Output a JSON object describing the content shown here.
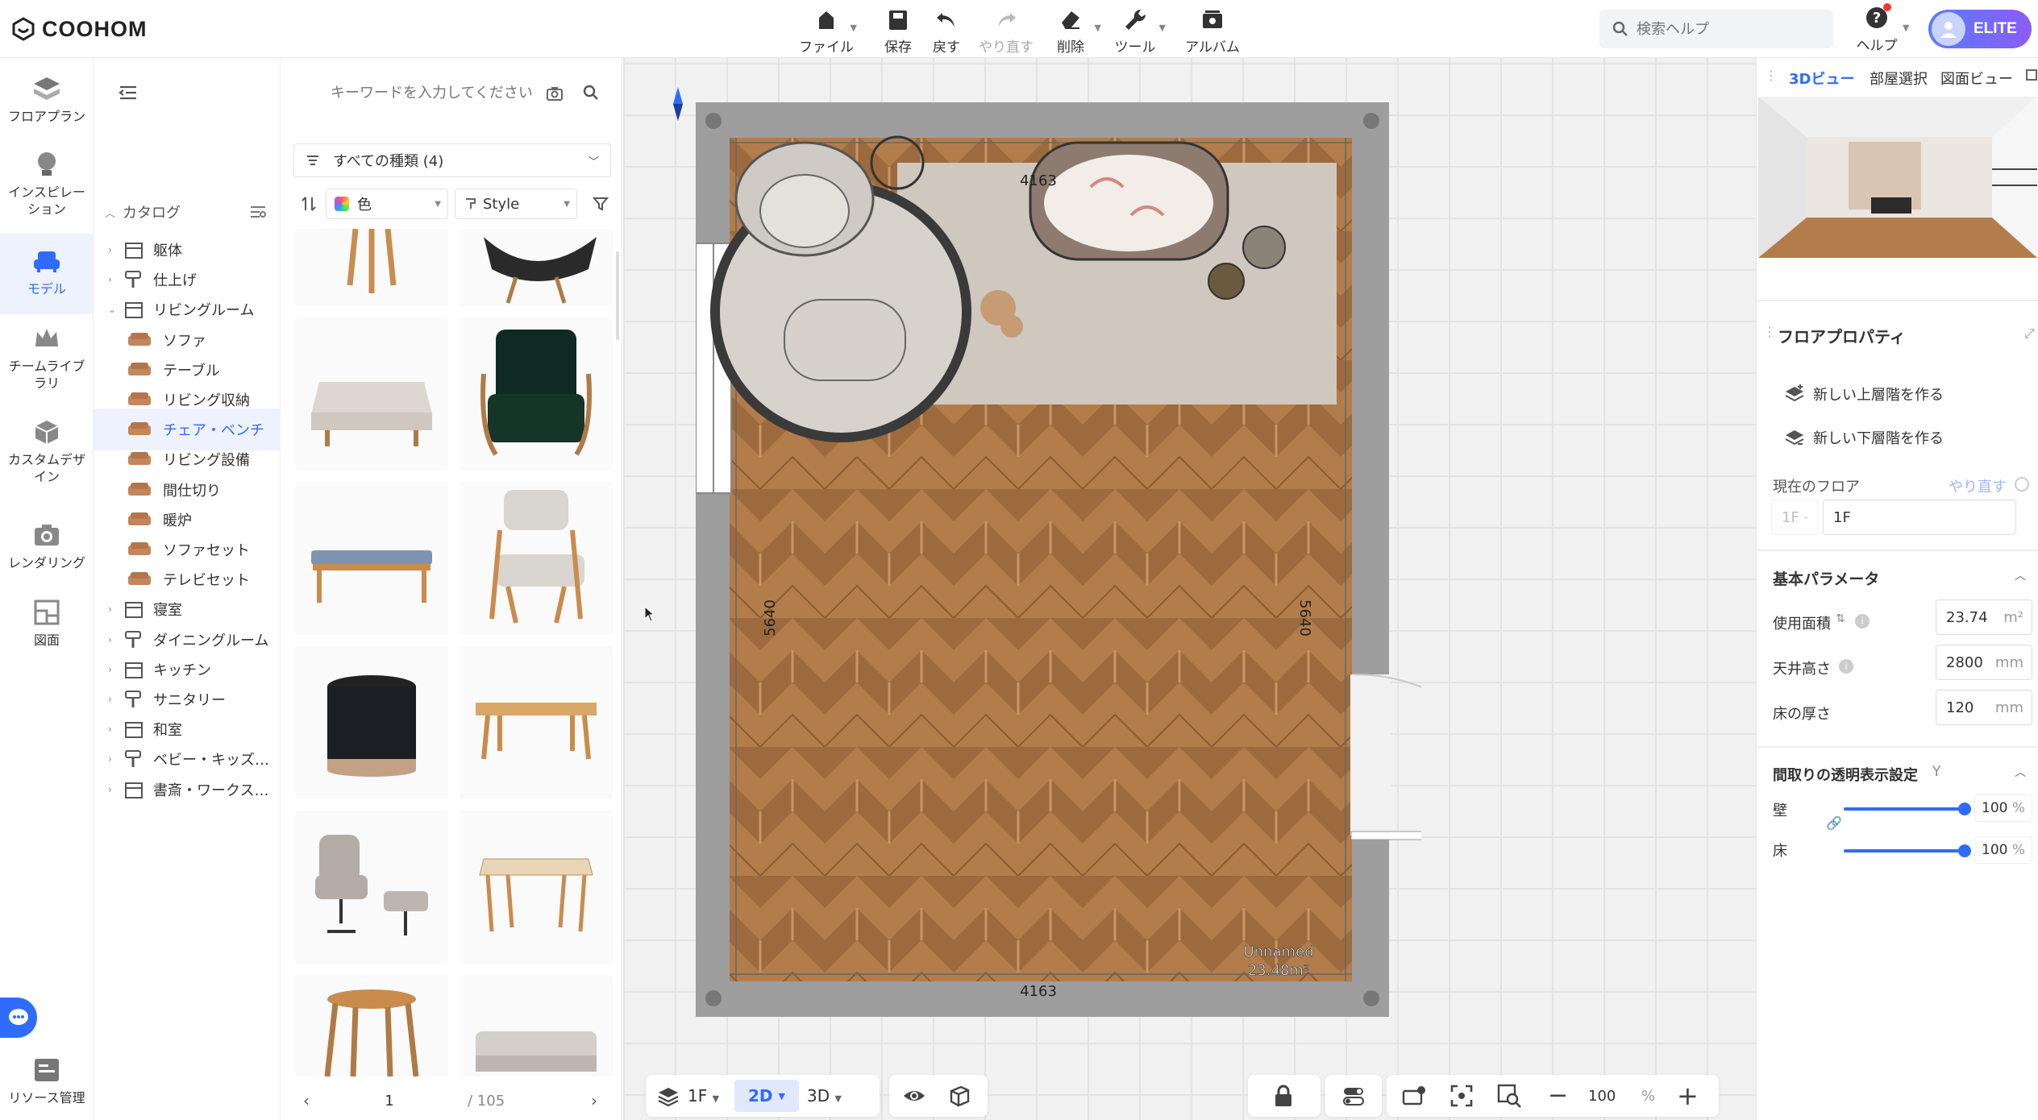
{
  "app": {
    "logo_text": "COOHOM"
  },
  "toolbar": {
    "file": "ファイル",
    "save": "保存",
    "undo": "戻す",
    "redo": "やり直す",
    "delete": "削除",
    "tools": "ツール",
    "album": "アルバム"
  },
  "search_help": {
    "placeholder": "検索ヘルプ"
  },
  "help": {
    "label": "ヘルプ"
  },
  "account": {
    "badge": "ELITE"
  },
  "rail": [
    {
      "label": "フロアプラン",
      "icon": "floorplan-icon"
    },
    {
      "label": "インスピレーション",
      "icon": "lightbulb-icon"
    },
    {
      "label": "モデル",
      "icon": "sofa-icon",
      "active": true
    },
    {
      "label": "チームライブラリ",
      "icon": "crown-icon"
    },
    {
      "label": "カスタムデザイン",
      "icon": "custom-box-icon"
    },
    {
      "label": "レンダリング",
      "icon": "camera-icon"
    },
    {
      "label": "図面",
      "icon": "drawing-icon"
    },
    {
      "label": "リソース管理",
      "icon": "resource-icon"
    }
  ],
  "catalog": {
    "title": "カタログ",
    "items": [
      {
        "label": "躯体",
        "level": 0,
        "expanded": false
      },
      {
        "label": "仕上げ",
        "level": 0,
        "expanded": false
      },
      {
        "label": "リビングルーム",
        "level": 0,
        "expanded": true
      },
      {
        "label": "ソファ",
        "level": 1
      },
      {
        "label": "テーブル",
        "level": 1
      },
      {
        "label": "リビング収納",
        "level": 1
      },
      {
        "label": "チェア・ベンチ",
        "level": 1,
        "active": true
      },
      {
        "label": "リビング設備",
        "level": 1
      },
      {
        "label": "間仕切り",
        "level": 1
      },
      {
        "label": "暖炉",
        "level": 1
      },
      {
        "label": "ソファセット",
        "level": 1
      },
      {
        "label": "テレビセット",
        "level": 1
      },
      {
        "label": "寝室",
        "level": 0
      },
      {
        "label": "ダイニングルーム",
        "level": 0
      },
      {
        "label": "キッチン",
        "level": 0
      },
      {
        "label": "サニタリー",
        "level": 0
      },
      {
        "label": "和室",
        "level": 0
      },
      {
        "label": "ベビー・キッズ…",
        "level": 0
      },
      {
        "label": "書斎・ワークス…",
        "level": 0
      }
    ]
  },
  "products": {
    "keyword_placeholder": "キーワードを入力してください",
    "type_filter": "すべての種類 (4)",
    "color_filter": "色",
    "style_filter": "Style",
    "page_current": "1",
    "page_total": "/ 105"
  },
  "floorplan": {
    "dimension_top": "4163",
    "dimension_bottom": "4163",
    "dimension_left": "5640",
    "dimension_right": "5640",
    "room_name": "Unnamed",
    "room_area": "23.48m²"
  },
  "bottom_bar": {
    "floor": "1F",
    "view_2d": "2D",
    "view_3d": "3D",
    "zoom_value": "100",
    "zoom_unit": "%"
  },
  "right_panel": {
    "tabs": [
      "3Dビュー",
      "部屋選択",
      "図面ビュー"
    ],
    "section_title": "フロアプロパティ",
    "new_upper_floor": "新しい上層階を作る",
    "new_lower_floor": "新しい下層階を作る",
    "current_floor_label": "現在のフロア",
    "redo_link": "やり直す",
    "floor_index": "1F",
    "floor_name": "1F",
    "basic_params_title": "基本パラメータ",
    "area_label": "使用面積",
    "area_value": "23.74",
    "area_unit": "m²",
    "ceiling_label": "天井高さ",
    "ceiling_value": "2800",
    "ceiling_unit": "mm",
    "floor_thickness_label": "床の厚さ",
    "floor_thickness_value": "120",
    "floor_thickness_unit": "mm",
    "transparency_title": "間取りの透明表示設定",
    "transparency_hotkey": "Y",
    "wall_label": "壁",
    "wall_value": "100",
    "wall_level": 1.0,
    "floor_label": "床",
    "floor_value": "100",
    "floor_level": 1.0,
    "percent_unit": "%"
  },
  "colors": {
    "accent": "#2f6bff",
    "wall": "#9e9e9e",
    "wood": "#b27d4b"
  }
}
